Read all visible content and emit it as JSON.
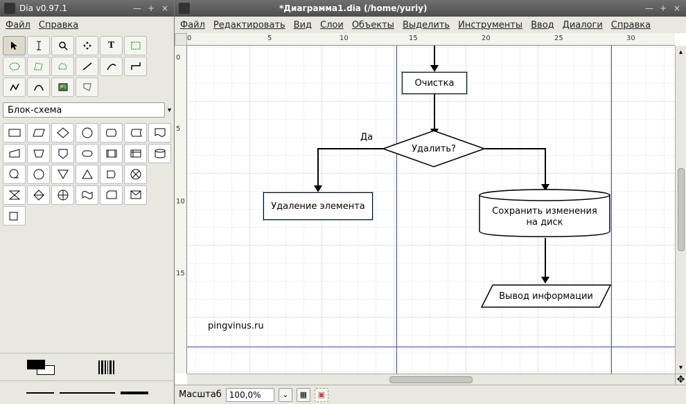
{
  "toolbox": {
    "title": "Dia v0.97.1",
    "menu": {
      "file": "Файл",
      "help": "Справка"
    },
    "shapeset": "Блок-схема"
  },
  "canvas_window": {
    "title": "*Диаграмма1.dia (/home/yuriy)",
    "menu": {
      "file": "Файл",
      "edit": "Редактировать",
      "view": "Вид",
      "layers": "Слои",
      "objects": "Объекты",
      "select": "Выделить",
      "tools": "Инструменты",
      "input": "Ввод",
      "dialogs": "Диалоги",
      "help": "Справка"
    }
  },
  "ruler_h": [
    "0",
    "5",
    "10",
    "15",
    "20",
    "25",
    "30"
  ],
  "ruler_v": [
    "0",
    "5",
    "10",
    "15"
  ],
  "flowchart": {
    "process1": "Очистка",
    "decision": "Удалить?",
    "decision_yes": "Да",
    "process2": "Удаление элемента",
    "storage_l1": "Сохранить изменения",
    "storage_l2": "на диск",
    "output": "Вывод информации",
    "watermark": "pingvinus.ru"
  },
  "status": {
    "zoom_label": "Масштаб",
    "zoom_value": "100,0%"
  },
  "chart_data": {
    "type": "flowchart",
    "nodes": [
      {
        "id": "n1",
        "shape": "process",
        "label": "Очистка"
      },
      {
        "id": "n2",
        "shape": "decision",
        "label": "Удалить?"
      },
      {
        "id": "n3",
        "shape": "process",
        "label": "Удаление элемента"
      },
      {
        "id": "n4",
        "shape": "storage",
        "label": "Сохранить изменения на диск"
      },
      {
        "id": "n5",
        "shape": "io",
        "label": "Вывод информации"
      }
    ],
    "edges": [
      {
        "from": "start",
        "to": "n1"
      },
      {
        "from": "n1",
        "to": "n2"
      },
      {
        "from": "n2",
        "to": "n3",
        "label": "Да"
      },
      {
        "from": "n2",
        "to": "n4"
      },
      {
        "from": "n4",
        "to": "n5"
      }
    ]
  }
}
